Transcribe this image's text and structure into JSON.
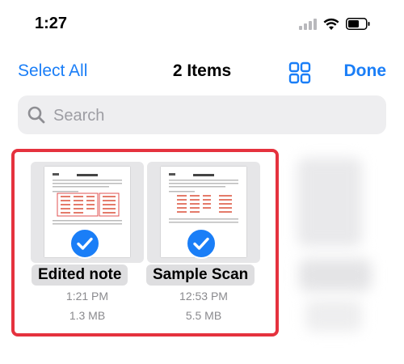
{
  "status_bar": {
    "time": "1:27",
    "signal_icon": "cellular-signal-icon",
    "wifi_icon": "wifi-icon",
    "battery_icon": "battery-icon"
  },
  "nav": {
    "select_all_label": "Select All",
    "title": "2 Items",
    "grid_icon": "grid-view-icon",
    "done_label": "Done"
  },
  "search": {
    "placeholder": "Search",
    "value": ""
  },
  "files": [
    {
      "name": "Edited note",
      "time": "1:21 PM",
      "size": "1.3 MB",
      "selected": true
    },
    {
      "name": "Sample Scan",
      "time": "12:53 PM",
      "size": "5.5 MB",
      "selected": true
    }
  ],
  "colors": {
    "accent": "#1a7ef7",
    "highlight_border": "#e5323e",
    "meta_text": "#8a8a8e"
  }
}
